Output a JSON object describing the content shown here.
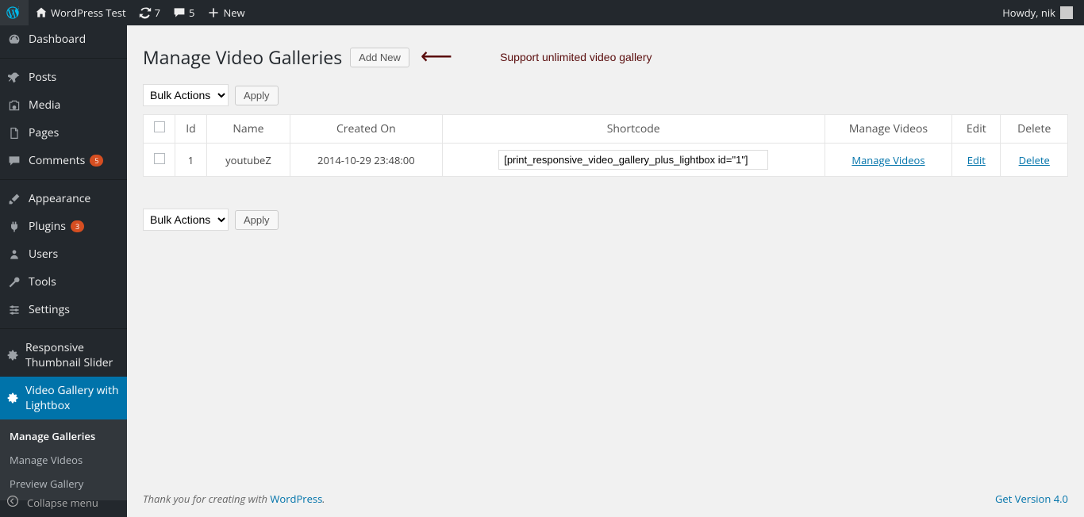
{
  "adminbar": {
    "site_name": "WordPress Test",
    "updates": "7",
    "comments": "5",
    "new_label": "New",
    "howdy": "Howdy, nik"
  },
  "sidebar": {
    "dashboard": "Dashboard",
    "posts": "Posts",
    "media": "Media",
    "pages": "Pages",
    "comments": "Comments",
    "comments_badge": "5",
    "appearance": "Appearance",
    "plugins": "Plugins",
    "plugins_badge": "3",
    "users": "Users",
    "tools": "Tools",
    "settings": "Settings",
    "rts": "Responsive Thumbnail Slider",
    "vgl": "Video Gallery with Lightbox",
    "sub_manage_galleries": "Manage Galleries",
    "sub_manage_videos": "Manage Videos",
    "sub_preview": "Preview Gallery",
    "collapse": "Collapse menu"
  },
  "page": {
    "title": "Manage Video Galleries",
    "add_new": "Add New",
    "annotation": "Support unlimited video gallery",
    "bulk_actions": "Bulk Actions",
    "apply": "Apply"
  },
  "table": {
    "headers": {
      "id": "Id",
      "name": "Name",
      "created": "Created On",
      "shortcode": "Shortcode",
      "manage": "Manage Videos",
      "edit": "Edit",
      "delete": "Delete"
    },
    "rows": [
      {
        "id": "1",
        "name": "youtubeZ",
        "created": "2014-10-29 23:48:00",
        "shortcode": "[print_responsive_video_gallery_plus_lightbox id=\"1\"]",
        "manage": "Manage Videos",
        "edit": "Edit",
        "delete": "Delete"
      }
    ]
  },
  "footer": {
    "thank_you": "Thank you for creating with ",
    "wordpress": "WordPress",
    "version": "Get Version 4.0"
  }
}
